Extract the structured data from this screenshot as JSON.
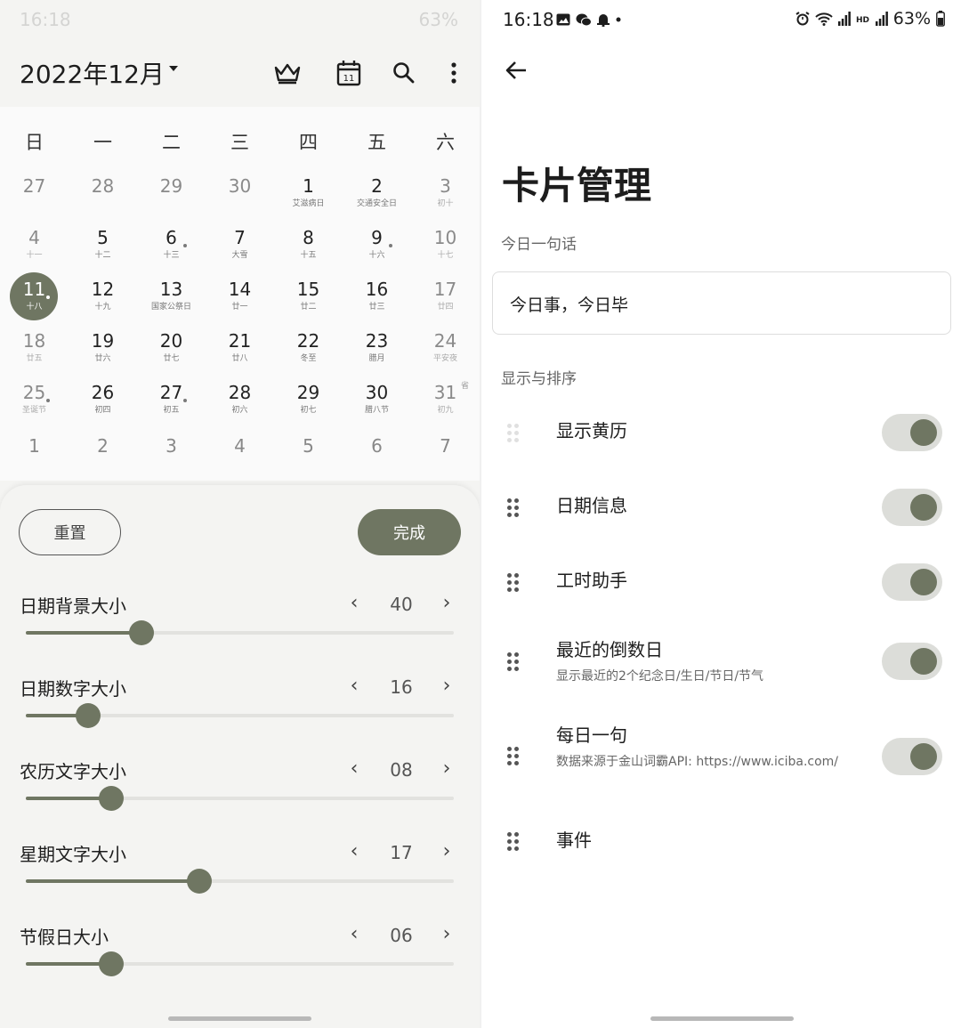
{
  "left": {
    "status": {
      "time": "16:18",
      "battery": "63%"
    },
    "header": {
      "month_title": "2022年12月"
    },
    "weekdays": [
      "日",
      "一",
      "二",
      "三",
      "四",
      "五",
      "六"
    ],
    "weeks": [
      [
        {
          "n": "27",
          "l": "",
          "dim": true
        },
        {
          "n": "28",
          "l": "",
          "dim": true
        },
        {
          "n": "29",
          "l": "",
          "dim": true
        },
        {
          "n": "30",
          "l": "",
          "dim": true
        },
        {
          "n": "1",
          "l": "艾滋病日"
        },
        {
          "n": "2",
          "l": "交通安全日"
        },
        {
          "n": "3",
          "l": "初十",
          "we": true
        }
      ],
      [
        {
          "n": "4",
          "l": "十一",
          "we": true
        },
        {
          "n": "5",
          "l": "十二"
        },
        {
          "n": "6",
          "l": "十三",
          "dot": true
        },
        {
          "n": "7",
          "l": "大雪"
        },
        {
          "n": "8",
          "l": "十五"
        },
        {
          "n": "9",
          "l": "十六",
          "dot": true
        },
        {
          "n": "10",
          "l": "十七",
          "we": true
        }
      ],
      [
        {
          "n": "11",
          "l": "十八",
          "sel": true,
          "dot": true
        },
        {
          "n": "12",
          "l": "十九"
        },
        {
          "n": "13",
          "l": "国家公祭日"
        },
        {
          "n": "14",
          "l": "廿一"
        },
        {
          "n": "15",
          "l": "廿二"
        },
        {
          "n": "16",
          "l": "廿三"
        },
        {
          "n": "17",
          "l": "廿四",
          "we": true
        }
      ],
      [
        {
          "n": "18",
          "l": "廿五",
          "we": true
        },
        {
          "n": "19",
          "l": "廿六"
        },
        {
          "n": "20",
          "l": "廿七"
        },
        {
          "n": "21",
          "l": "廿八"
        },
        {
          "n": "22",
          "l": "冬至"
        },
        {
          "n": "23",
          "l": "腊月"
        },
        {
          "n": "24",
          "l": "平安夜",
          "we": true
        }
      ],
      [
        {
          "n": "25",
          "l": "圣诞节",
          "we": true,
          "dot": true
        },
        {
          "n": "26",
          "l": "初四"
        },
        {
          "n": "27",
          "l": "初五",
          "dot": true
        },
        {
          "n": "28",
          "l": "初六"
        },
        {
          "n": "29",
          "l": "初七"
        },
        {
          "n": "30",
          "l": "腊八节"
        },
        {
          "n": "31",
          "l": "初九",
          "we": true,
          "tag": "省"
        }
      ]
    ],
    "next_row": [
      "1",
      "2",
      "3",
      "4",
      "5",
      "6",
      "7"
    ],
    "buttons": {
      "reset": "重置",
      "done": "完成"
    },
    "settings": [
      {
        "label": "日期背景大小",
        "value": "40",
        "fill": 0.27
      },
      {
        "label": "日期数字大小",
        "value": "16",
        "fill": 0.145
      },
      {
        "label": "农历文字大小",
        "value": "08",
        "fill": 0.2
      },
      {
        "label": "星期文字大小",
        "value": "17",
        "fill": 0.405
      },
      {
        "label": "节假日大小",
        "value": "06",
        "fill": 0.2
      }
    ]
  },
  "right": {
    "status": {
      "time": "16:18",
      "battery": "63%"
    },
    "title": "卡片管理",
    "quote_section": "今日一句话",
    "quote_text": "今日事，今日毕",
    "order_section": "显示与排序",
    "cards": [
      {
        "title": "显示黄历",
        "sub": "",
        "toggle": true,
        "faded": true
      },
      {
        "title": "日期信息",
        "sub": "",
        "toggle": true
      },
      {
        "title": "工时助手",
        "sub": "",
        "toggle": true
      },
      {
        "title": "最近的倒数日",
        "sub": "显示最近的2个纪念日/生日/节日/节气",
        "toggle": true
      },
      {
        "title": "每日一句",
        "sub": "数据来源于金山词霸API: https://www.iciba.com/",
        "toggle": true
      },
      {
        "title": "事件",
        "sub": "",
        "toggle": false
      }
    ]
  },
  "colors": {
    "accent": "#6f7662",
    "toggle_track": "#dcddd9"
  }
}
